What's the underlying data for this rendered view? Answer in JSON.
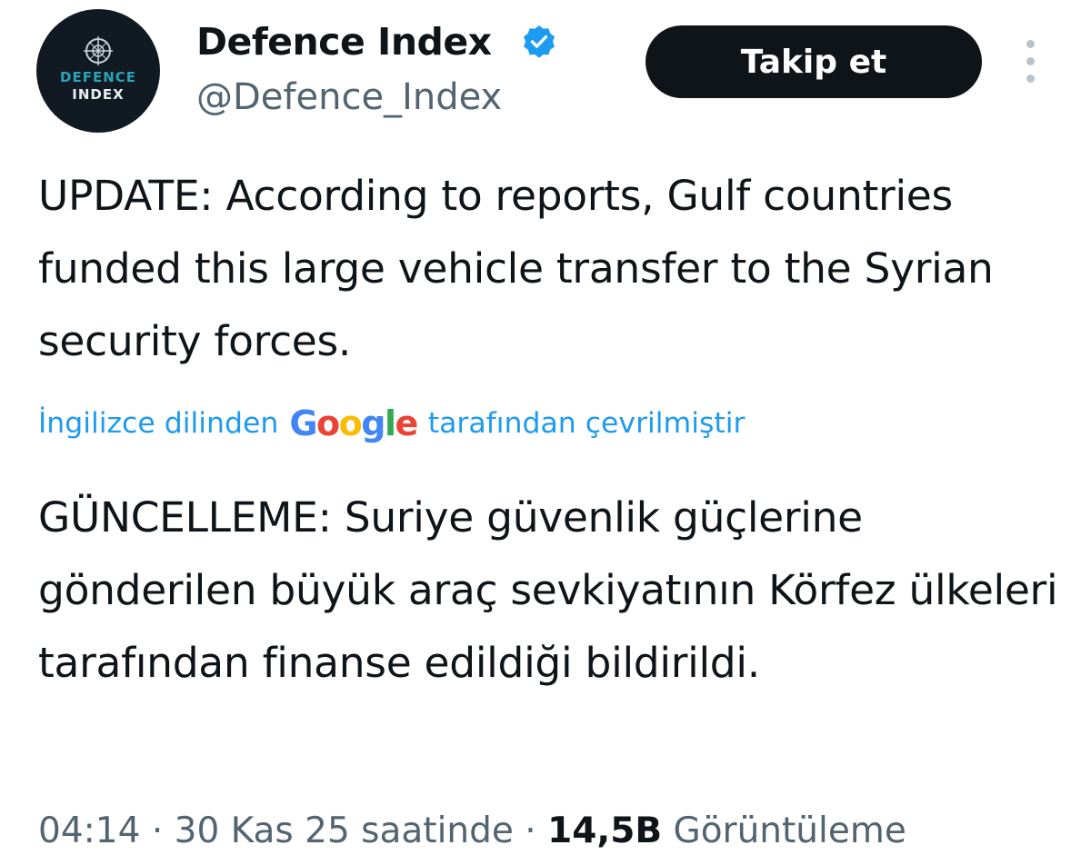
{
  "author": {
    "display_name": "Defence Index",
    "handle": "@Defence_Index",
    "avatar_text_line1": "DEFENCE",
    "avatar_text_line2": "INDEX",
    "verified": true
  },
  "header": {
    "follow_label": "Takip et",
    "more_icon": "more-vertical-icon"
  },
  "tweet": {
    "original_text": "UPDATE: According to reports, Gulf countries funded this large vehicle transfer to the Syrian security forces.",
    "translation_prefix": "İngilizce dilinden",
    "translation_provider": "Google",
    "translation_suffix": "tarafından çevrilmiştir",
    "translated_text": "GÜNCELLEME: Suriye güvenlik güçlerine gönderilen büyük araç sevkiyatının Körfez ülkeleri tarafından finanse edildiği bildirildi."
  },
  "meta": {
    "time": "04:14",
    "separator": "·",
    "date": "30 Kas 25 saatinde",
    "views_count": "14,5B",
    "views_label": "Görüntüleme"
  },
  "colors": {
    "accent": "#1d9bf0",
    "text": "#0f1419",
    "secondary": "#536471",
    "button_bg": "#0f1419"
  }
}
